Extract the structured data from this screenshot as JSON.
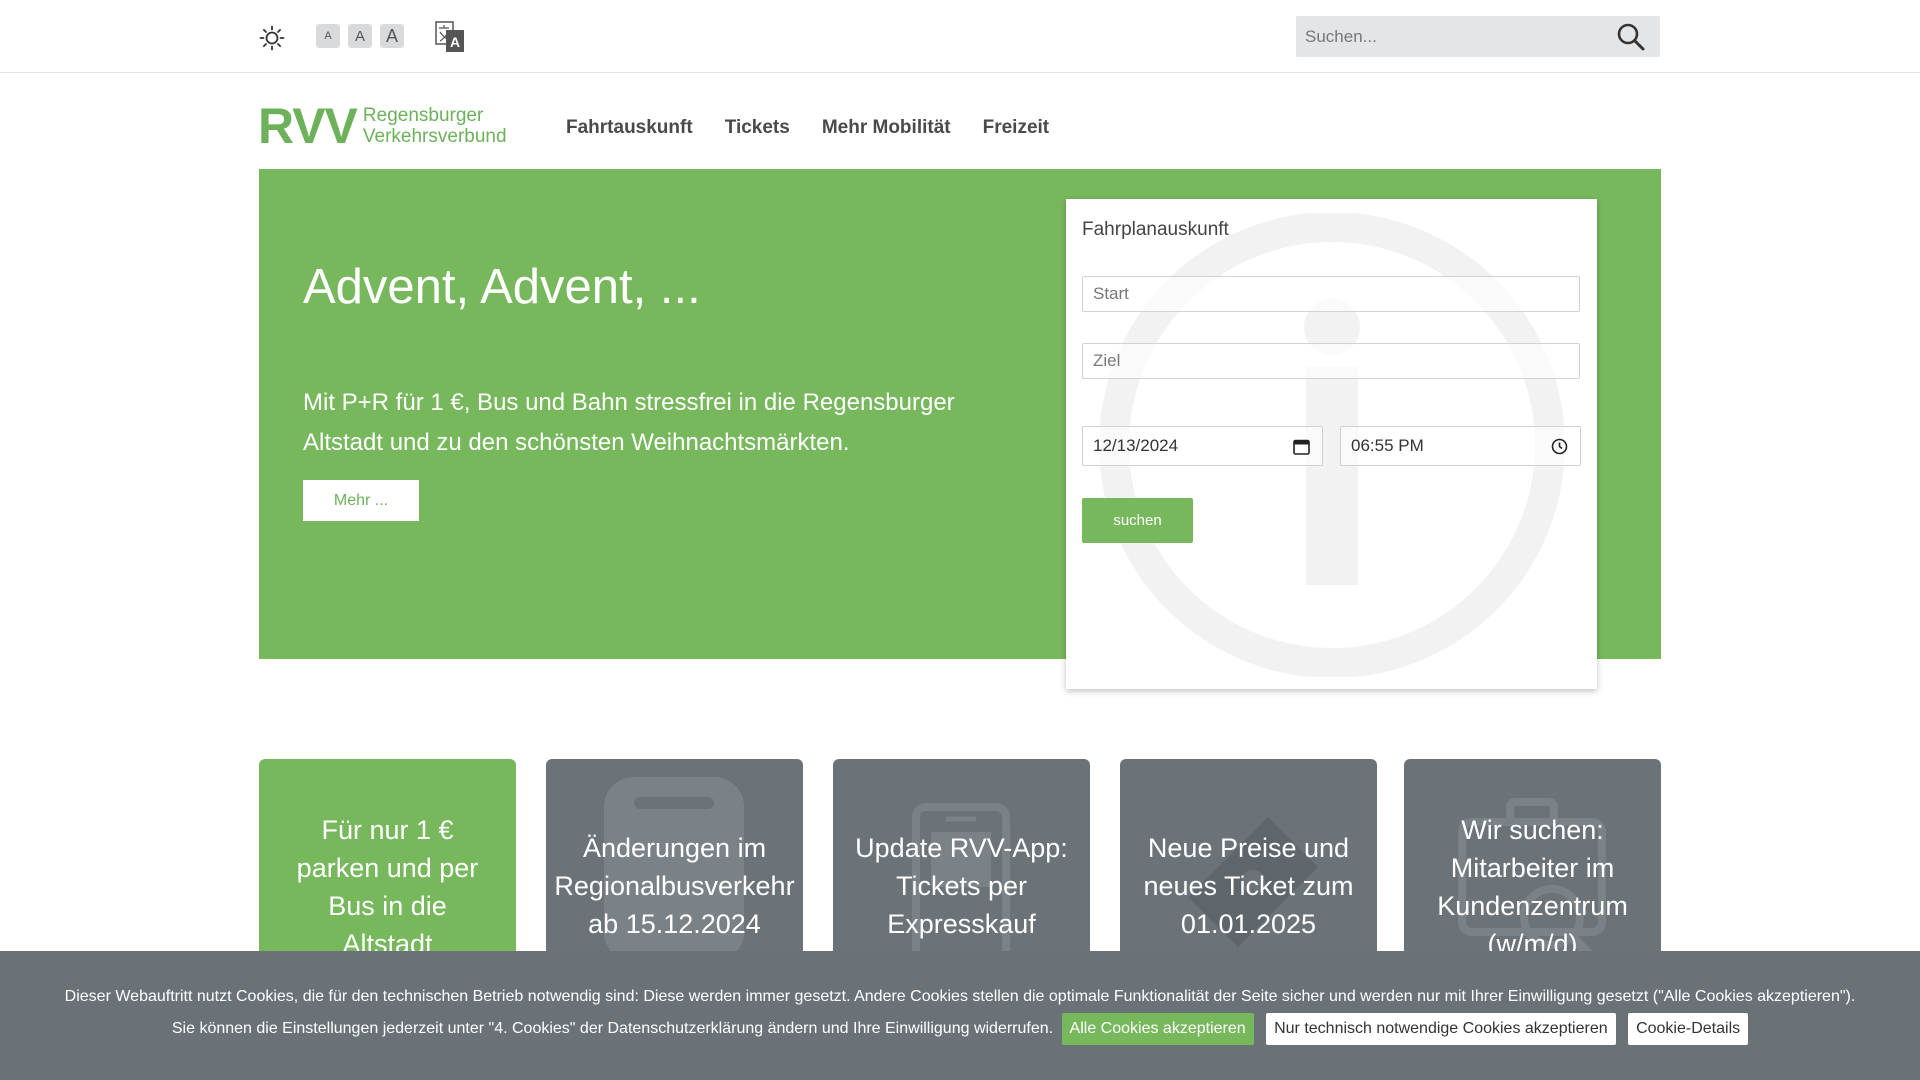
{
  "topbar": {
    "theme_icon": "sun-icon",
    "font_sizes": [
      "A",
      "A",
      "A"
    ],
    "language_icon": "translate-icon",
    "search": {
      "placeholder": "Suchen...",
      "value": ""
    }
  },
  "header": {
    "logo": {
      "abbr": "RVV",
      "line1": "Regensburger",
      "line2": "Verkehrsverbund"
    },
    "nav": [
      {
        "label": "Fahrtauskunft"
      },
      {
        "label": "Tickets"
      },
      {
        "label": "Mehr Mobilität"
      },
      {
        "label": "Freizeit"
      }
    ]
  },
  "hero": {
    "title": "Advent, Advent, ...",
    "text": "Mit P+R für 1 €, Bus und Bahn stressfrei in die Regensburger Altstadt und zu den schönsten Weihnachtsmärkten.",
    "button": "Mehr ..."
  },
  "planner": {
    "title": "Fahrplanauskunft",
    "start_placeholder": "Start",
    "ziel_placeholder": "Ziel",
    "date": "12/13/2024",
    "time": "06:55 PM",
    "submit": "suchen"
  },
  "tiles": [
    {
      "text": "Für nur 1 €\nparken und per\nBus in die\nAltstadt",
      "icon": "parking-icon"
    },
    {
      "text": "Änderungen im\nRegionalbusverkehr\nab 15.12.2024",
      "icon": "bus-icon"
    },
    {
      "text": "Update RVV-App:\nTickets per\nExpresskauf",
      "icon": "smartphone-icon"
    },
    {
      "text": "Neue Preise und\nneues Ticket zum\n01.01.2025",
      "icon": "ticket-icon"
    },
    {
      "text": "Wir suchen:\nMitarbeiter im\nKundenzentrum\n(w/m/d)",
      "icon": "briefcase-search-icon"
    }
  ],
  "cookie": {
    "text": "Dieser Webauftritt nutzt Cookies, die für den technischen Betrieb notwendig sind: Diese werden immer gesetzt. Andere Cookies stellen die optimale Funktionalität der Seite sicher und werden nur mit Ihrer Einwilligung gesetzt (\"Alle Cookies akzeptieren\"). Sie können die Einstellungen jederzeit unter \"4. Cookies\" der Datenschutzerklärung ändern und Ihre Einwilligung widerrufen.",
    "accept_all": "Alle Cookies akzeptieren",
    "accept_necessary": "Nur technisch notwendige Cookies akzeptieren",
    "details": "Cookie-Details"
  },
  "colors": {
    "brand_green": "#77b85c",
    "tile_gray": "#6c7378",
    "cookie_bg": "#6b7277"
  }
}
